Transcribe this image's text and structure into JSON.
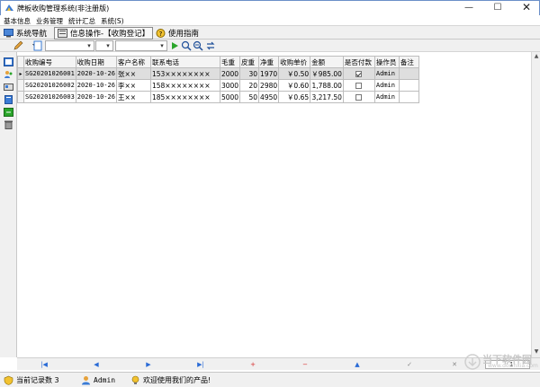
{
  "window": {
    "title": "牌板收购管理系统(非注册版)",
    "controls": [
      "—",
      "☐",
      "✕"
    ]
  },
  "menubar": {
    "items": [
      {
        "label": "基本信息"
      },
      {
        "label": "业务管理"
      },
      {
        "label": "统计汇总"
      },
      {
        "label": "系统(S)"
      }
    ]
  },
  "navbar": {
    "tabs": [
      {
        "label": "系统导航",
        "icon": "monitor-icon"
      },
      {
        "label": "信息操作-【收购登记】",
        "icon": "form-icon",
        "active": true
      },
      {
        "label": "使用指南",
        "icon": "help-icon"
      }
    ]
  },
  "toolbar": {
    "combo1": "",
    "combo2": "",
    "combo3": ""
  },
  "grid": {
    "columns": [
      "收购编号",
      "收购日期",
      "客户名称",
      "联系电话",
      "毛重",
      "皮重",
      "净重",
      "收购单价",
      "金额",
      "是否付款",
      "操作员",
      "备注"
    ],
    "rows": [
      {
        "id": "SG20201026001",
        "date": "2020-10-26",
        "customer": "张××",
        "phone": "153××××××××",
        "gross": "2000",
        "tare": "30",
        "net": "1970",
        "price": "￥0.50",
        "amount": "￥985.00",
        "paid": true,
        "operator": "Admin",
        "note": "",
        "selected": true
      },
      {
        "id": "SG20201026002",
        "date": "2020-10-26",
        "customer": "李××",
        "phone": "158××××××××",
        "gross": "3000",
        "tare": "20",
        "net": "2980",
        "price": "￥0.60",
        "amount": "1,788.00",
        "paid": false,
        "operator": "Admin",
        "note": ""
      },
      {
        "id": "SG20201026003",
        "date": "2020-10-26",
        "customer": "王××",
        "phone": "185××××××××",
        "gross": "5000",
        "tare": "50",
        "net": "4950",
        "price": "￥0.65",
        "amount": "3,217.50",
        "paid": false,
        "operator": "Admin",
        "note": ""
      }
    ]
  },
  "pager": {
    "buttons": [
      {
        "label": "|◀",
        "name": "first-page-button",
        "color": "blue"
      },
      {
        "label": "◀",
        "name": "prev-button",
        "color": "blue"
      },
      {
        "label": "▶",
        "name": "next-button",
        "color": "blue"
      },
      {
        "label": "▶|",
        "name": "last-page-button",
        "color": "blue"
      },
      {
        "label": "+",
        "name": "add-record-button",
        "color": "red"
      },
      {
        "label": "−",
        "name": "delete-record-button",
        "color": "red"
      },
      {
        "label": "▲",
        "name": "edit-record-button",
        "color": "blue"
      },
      {
        "label": "✓",
        "name": "confirm-button",
        "color": "gray"
      },
      {
        "label": "✕",
        "name": "cancel-button",
        "color": "gray"
      }
    ],
    "page_value": "1"
  },
  "status": {
    "record_count_label": "当前记录数 3",
    "user": "Admin",
    "welcome": "欢迎使用我们的产品!"
  },
  "watermark": {
    "text": "当下软件园",
    "url": "www.downxia.com"
  }
}
